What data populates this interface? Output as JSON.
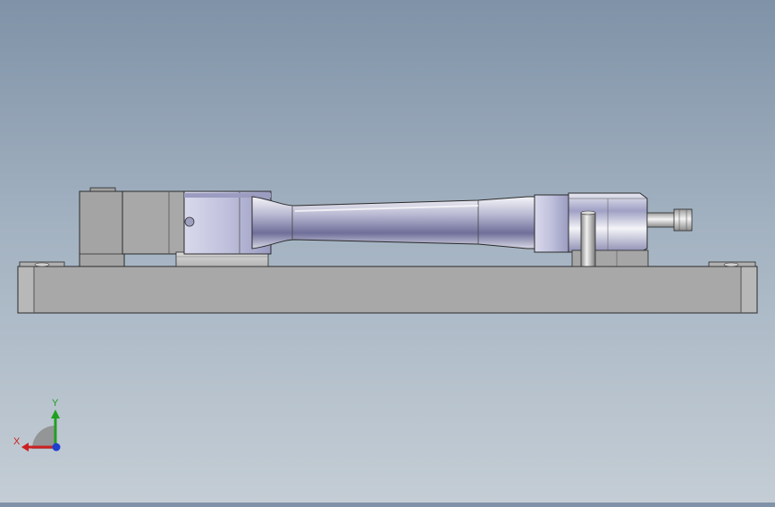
{
  "viewport": {
    "background_top": "#7f92a7",
    "background_bottom": "#c4cdd5",
    "model_edge_color": "#2a2a2a",
    "base_plate_color": "#a6a6a6",
    "metal_accent_color": "#c9cbdc"
  },
  "triad": {
    "x_label": "X",
    "y_label": "Y",
    "x_color": "#cc2020",
    "y_color": "#20a020",
    "z_color": "#1f3fd0"
  }
}
